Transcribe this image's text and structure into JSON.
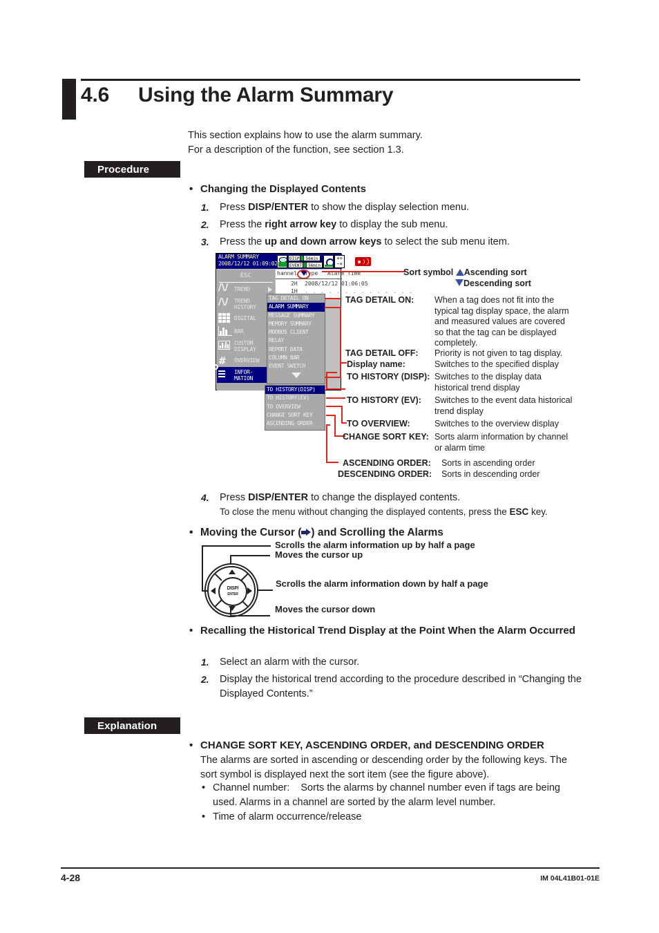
{
  "heading": {
    "number": "4.6",
    "title": "Using the Alarm Summary"
  },
  "intro": {
    "line1": "This section explains how to use the alarm summary.",
    "line2": "For a description of the function, see section 1.3."
  },
  "sections": {
    "procedure": "Procedure",
    "explanation": "Explanation"
  },
  "procedure": {
    "changing": {
      "heading": "Changing the Displayed Contents",
      "steps": [
        {
          "n": "1.",
          "pre": "Press ",
          "strong": "DISP/ENTER",
          "post": " to show the display selection menu."
        },
        {
          "n": "2.",
          "pre": "Press the ",
          "strong": "right arrow key",
          "post": " to display the sub menu."
        },
        {
          "n": "3.",
          "pre": "Press the ",
          "strong": "up and down arrow keys",
          "post": " to select the sub menu item."
        },
        {
          "n": "4.",
          "pre": "Press ",
          "strong": "DISP/ENTER",
          "post": " to change the displayed contents."
        }
      ],
      "step4_note_pre": "To close the menu without changing the displayed contents, press the ",
      "step4_note_strong": "ESC",
      "step4_note_post": " key."
    },
    "moving": {
      "heading_pre": "Moving the Cursor (",
      "heading_post": ") and Scrolling the Alarms"
    },
    "recalling": {
      "heading": "Recalling the Historical Trend Display at the Point When the Alarm Occurred",
      "steps": [
        {
          "n": "1.",
          "text": "Select an alarm with the cursor."
        },
        {
          "n": "2.",
          "text": "Display the historical trend according to the procedure described in “Changing the Displayed Contents.”"
        }
      ]
    }
  },
  "dpad": {
    "center_line1": "DISP/",
    "center_line2": "ENTER",
    "labels": {
      "left": "Scrolls the alarm information up by half a page",
      "up": "Moves the cursor up",
      "right": "Scrolls the alarm information down by half a page",
      "down": "Moves the cursor down"
    }
  },
  "lcd": {
    "title_line1": "ALARM SUMMARY",
    "title_line2": "2008/12/12 01:09:02",
    "status": {
      "disp_label": "DISP",
      "disp_value": "56min",
      "event_label": "EVENT",
      "event_value": "56min"
    },
    "table": {
      "headers": [
        "hannel",
        "Type",
        "Alarm Time"
      ],
      "rows": [
        {
          "c1": "2H",
          "c2": "2008/12/12 01:06:05"
        },
        {
          "c1": "1H",
          "c2": ""
        }
      ]
    },
    "esc": "ESC",
    "menu": [
      {
        "label": "TREND",
        "icon": "trend-icon",
        "arrow": true
      },
      {
        "label": "TREND\nHISTORY",
        "icon": "trend-history-icon",
        "arrow": true
      },
      {
        "label": "DIGITAL",
        "icon": "digital-icon",
        "arrow": true
      },
      {
        "label": "BAR",
        "icon": "bar-icon",
        "arrow": true
      },
      {
        "label": "CUSTOM\nDISPLAY",
        "icon": "custom-display-icon",
        "arrow": true
      },
      {
        "label": "OVERVIEW",
        "icon": "overview-icon",
        "arrow": false
      },
      {
        "label": "INFOR-\nMATION",
        "icon": "information-icon",
        "arrow": true,
        "selected": true
      }
    ],
    "submenu1": [
      {
        "label": "TAG DETAIL ON"
      },
      {
        "label": "ALARM SUMMARY",
        "selected": true
      },
      {
        "label": "MESSAGE SUMMARY"
      },
      {
        "label": "MEMORY SUMMARY"
      },
      {
        "label": "MODBUS CLIENT"
      },
      {
        "label": "RELAY"
      },
      {
        "label": "REPORT DATA"
      },
      {
        "label": "COLUMN BAR"
      },
      {
        "label": "EVENT SWITCH"
      }
    ],
    "submenu2": [
      {
        "label": "TO HISTORY(DISP)",
        "selected": true
      },
      {
        "label": "TO HISTORY(EV)"
      },
      {
        "label": "TO OVERVIEW"
      },
      {
        "label": "CHANGE SORT KEY"
      },
      {
        "label": "ASCENDING ORDER"
      }
    ]
  },
  "annotations": {
    "sort_symbol_label": "Sort symbol",
    "ascending": "Ascending sort",
    "descending": "Descending sort",
    "items": [
      {
        "term": "TAG DETAIL ON:",
        "desc": "When a tag does not fit into the typical  tag display space, the alarm and measured values are covered so that the tag can be displayed completely."
      },
      {
        "term": "TAG DETAIL OFF:",
        "desc": "Priority is not given to tag display."
      },
      {
        "term": "Display name:",
        "desc": "Switches to the specified display"
      },
      {
        "term": "TO HISTORY (DISP):",
        "desc": "Switches to the display data historical trend display"
      },
      {
        "term": "TO HISTORY (EV):",
        "desc": "Switches to the event data historical trend display"
      },
      {
        "term": "TO OVERVIEW:",
        "desc": "Switches to the overview display"
      },
      {
        "term": "CHANGE SORT KEY:",
        "desc": "Sorts alarm information by channel or alarm time"
      },
      {
        "term": "ASCENDING ORDER:",
        "desc": "Sorts in ascending order"
      },
      {
        "term": "DESCENDING ORDER:",
        "desc": "Sorts in descending order"
      }
    ]
  },
  "explanation": {
    "heading": "CHANGE SORT KEY, ASCENDING ORDER, and DESCENDING ORDER",
    "body": "The alarms are sorted in ascending or descending order by the following keys. The sort symbol is displayed next the sort item (see the figure above).",
    "bullets": [
      {
        "term": "Channel number:",
        "desc": "Sorts the alarms by channel number even if tags are being used. Alarms in a channel are sorted by the alarm level number."
      },
      {
        "term": "",
        "desc": "Time of alarm occurrence/release"
      }
    ]
  },
  "footer": {
    "page": "4-28",
    "doc": "IM 04L41B01-01E"
  }
}
